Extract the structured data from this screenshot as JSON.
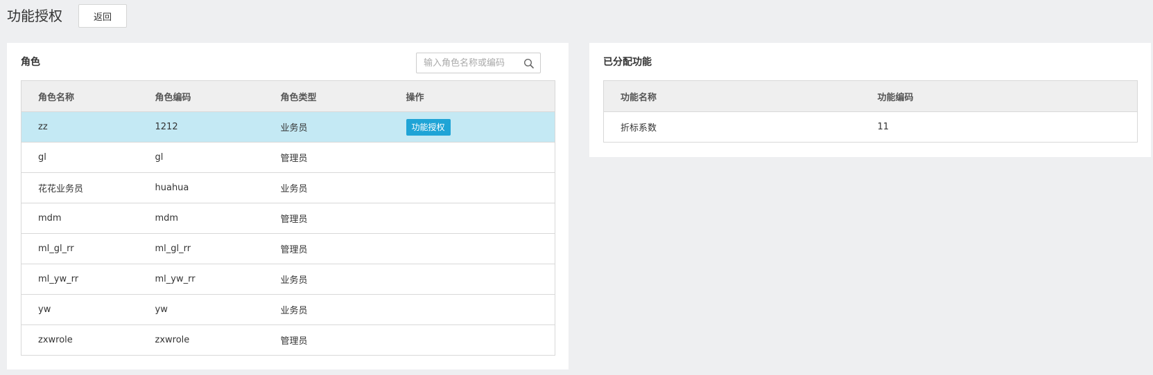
{
  "page": {
    "title": "功能授权",
    "back_label": "返回"
  },
  "roles_panel": {
    "title": "角色",
    "search_placeholder": "输入角色名称或编码",
    "columns": [
      "角色名称",
      "角色编码",
      "角色类型",
      "操作"
    ],
    "action_label": "功能授权",
    "rows": [
      {
        "name": "zz",
        "code": "1212",
        "type": "业务员",
        "selected": true
      },
      {
        "name": "gl",
        "code": "gl",
        "type": "管理员"
      },
      {
        "name": "花花业务员",
        "code": "huahua",
        "type": "业务员"
      },
      {
        "name": "mdm",
        "code": "mdm",
        "type": "管理员"
      },
      {
        "name": "ml_gl_rr",
        "code": "ml_gl_rr",
        "type": "管理员"
      },
      {
        "name": "ml_yw_rr",
        "code": "ml_yw_rr",
        "type": "业务员"
      },
      {
        "name": "yw",
        "code": "yw",
        "type": "业务员"
      },
      {
        "name": "zxwrole",
        "code": "zxwrole",
        "type": "管理员"
      }
    ]
  },
  "functions_panel": {
    "title": "已分配功能",
    "columns": [
      "功能名称",
      "功能编码"
    ],
    "rows": [
      {
        "name": "折标系数",
        "code": "11"
      }
    ]
  },
  "colors": {
    "selected_row": "#c4e9f4",
    "action_button": "#1fa4d6"
  },
  "icons": {
    "search": "search-icon"
  }
}
